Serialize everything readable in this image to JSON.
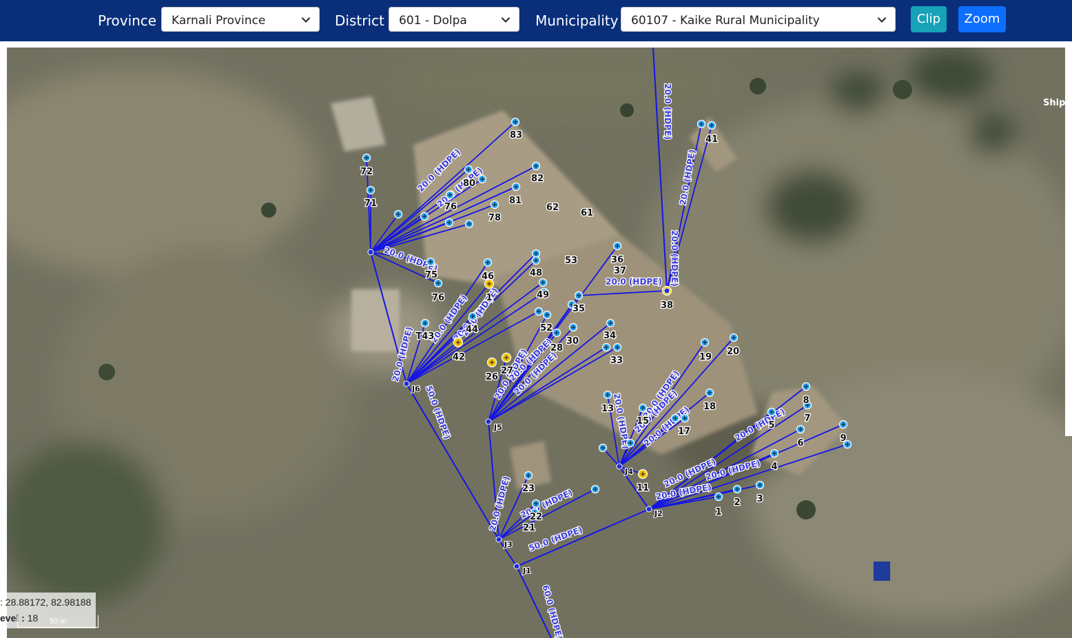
{
  "filters": {
    "province_label": "Province",
    "province_value": "Karnali Province",
    "district_label": "District",
    "district_value": "601 - Dolpa",
    "municipality_label": "Municipality",
    "municipality_value": "60107 - Kaike Rural Municipality"
  },
  "buttons": {
    "clip": "Clip",
    "zoom": "Zoom"
  },
  "colors": {
    "header": "#0a2f7a",
    "clip": "#17a2b8",
    "zoom": "#0d6efd",
    "pipe": "#1515e6",
    "tap": "#29a8f5",
    "source": "#f2c200"
  },
  "map": {
    "coords_text": ": 28.88172, 82.98188",
    "level_label": "evel :",
    "level_value": "18",
    "scale_label": "50 m",
    "poi_label": "Ship",
    "pipe_labels": [
      "20.0 (HDPE)",
      "50.0 (HDPE)",
      "60.0 (HDPE)"
    ],
    "junctions": [
      "J1",
      "J2",
      "J3",
      "J4",
      "J5",
      "J6"
    ],
    "nodes": [
      "83",
      "72",
      "71",
      "80",
      "82",
      "76",
      "81",
      "78",
      "62",
      "61",
      "41",
      "53",
      "36",
      "37",
      "46",
      "48",
      "75",
      "76",
      "1",
      "49",
      "35",
      "38",
      "T43",
      "44",
      "52",
      "34",
      "30",
      "42",
      "28",
      "33",
      "19",
      "20",
      "27",
      "26",
      "18",
      "13",
      "15",
      "17",
      "8",
      "7",
      "5",
      "6",
      "9",
      "4",
      "23",
      "22",
      "21",
      "11",
      "3",
      "2",
      "1"
    ]
  }
}
